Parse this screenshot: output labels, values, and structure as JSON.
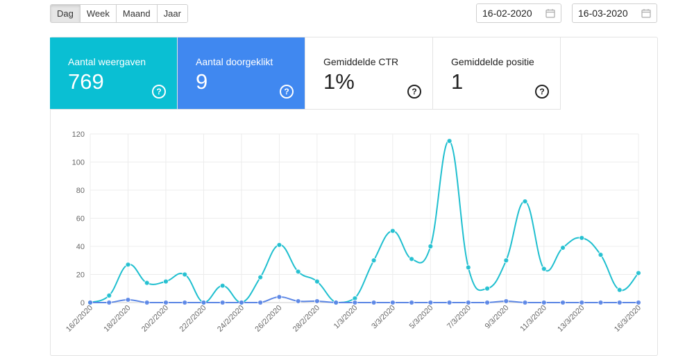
{
  "range_buttons": [
    {
      "label": "Dag",
      "active": true
    },
    {
      "label": "Week",
      "active": false
    },
    {
      "label": "Maand",
      "active": false
    },
    {
      "label": "Jaar",
      "active": false
    }
  ],
  "date_from": "16-02-2020",
  "date_to": "16-03-2020",
  "stats": [
    {
      "label": "Aantal weergaven",
      "value": "769",
      "color": "#0abfd3"
    },
    {
      "label": "Aantal doorgeklikt",
      "value": "9",
      "color": "#4088f0"
    },
    {
      "label": "Gemiddelde CTR",
      "value": "1%"
    },
    {
      "label": "Gemiddelde positie",
      "value": "1"
    }
  ],
  "help_glyph": "?",
  "chart_data": {
    "type": "line",
    "x": [
      "16/2/2020",
      "17/2/2020",
      "18/2/2020",
      "19/2/2020",
      "20/2/2020",
      "21/2/2020",
      "22/2/2020",
      "23/2/2020",
      "24/2/2020",
      "25/2/2020",
      "26/2/2020",
      "27/2/2020",
      "28/2/2020",
      "29/2/2020",
      "1/3/2020",
      "2/3/2020",
      "3/3/2020",
      "4/3/2020",
      "5/3/2020",
      "6/3/2020",
      "7/3/2020",
      "8/3/2020",
      "9/3/2020",
      "10/3/2020",
      "11/3/2020",
      "12/3/2020",
      "13/3/2020",
      "14/3/2020",
      "15/3/2020",
      "16/3/2020"
    ],
    "x_tick_labels": [
      "16/2/2020",
      "18/2/2020",
      "20/2/2020",
      "22/2/2020",
      "24/2/2020",
      "26/2/2020",
      "28/2/2020",
      "1/3/2020",
      "3/3/2020",
      "5/3/2020",
      "7/3/2020",
      "9/3/2020",
      "11/3/2020",
      "13/3/2020",
      "16/3/2020"
    ],
    "series": [
      {
        "values": [
          0,
          5,
          27,
          14,
          15,
          20,
          0,
          12,
          0,
          18,
          41,
          22,
          15,
          0,
          3,
          30,
          51,
          31,
          40,
          115,
          25,
          10,
          30,
          72,
          24,
          39,
          46,
          34,
          9,
          21
        ],
        "color": "#1fbfcf"
      },
      {
        "values": [
          0,
          0,
          2,
          0,
          0,
          0,
          0,
          0,
          0,
          0,
          4,
          1,
          1,
          0,
          0,
          0,
          0,
          0,
          0,
          0,
          0,
          0,
          1,
          0,
          0,
          0,
          0,
          0,
          0,
          0
        ],
        "color": "#5b86e5"
      }
    ],
    "y_ticks": [
      0,
      20,
      40,
      60,
      80,
      100,
      120
    ],
    "ylim": [
      0,
      120
    ],
    "grid": true
  }
}
